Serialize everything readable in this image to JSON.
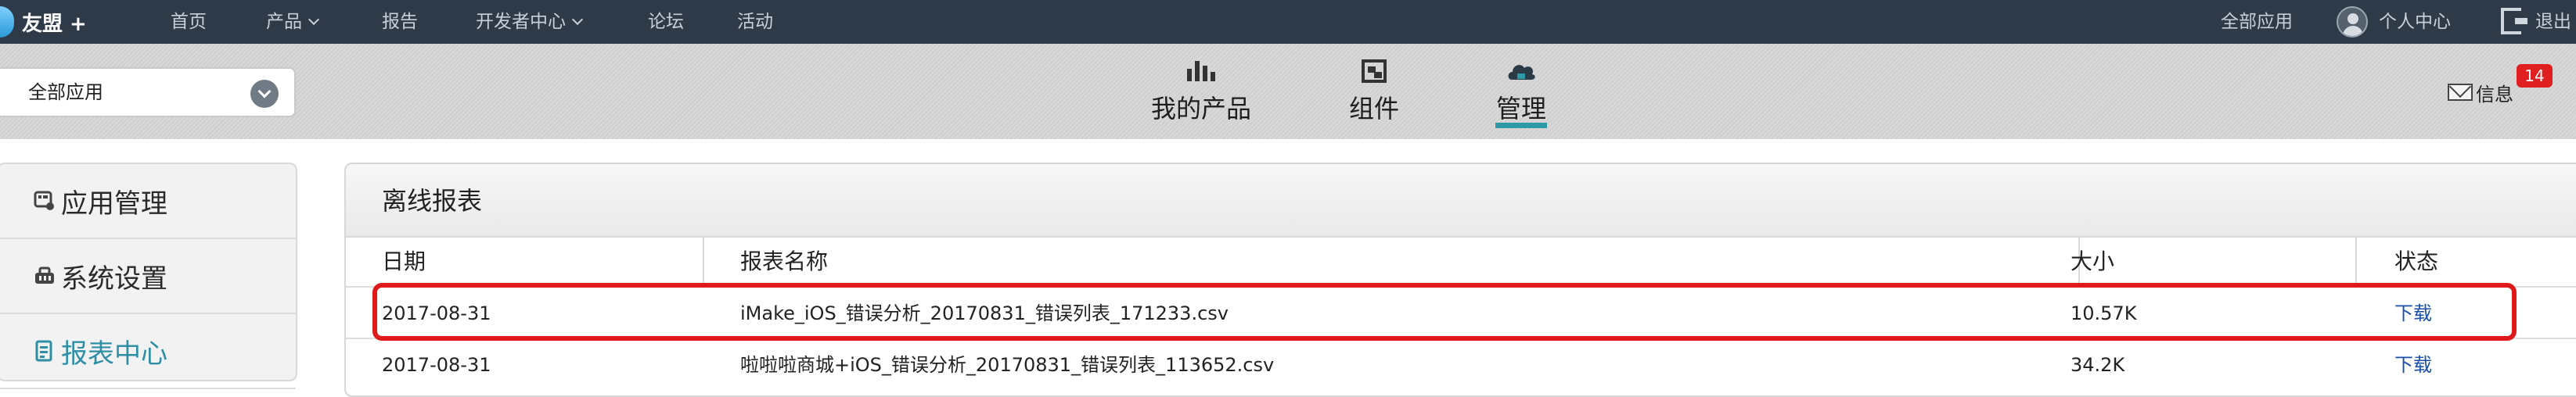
{
  "topnav": {
    "logo": "友盟 +",
    "items": [
      "首页",
      "产品",
      "报告",
      "开发者中心",
      "论坛",
      "活动"
    ],
    "right": {
      "all_apps": "全部应用",
      "user_center": "个人中心",
      "logout": "退出"
    }
  },
  "subbar": {
    "app_select": "全部应用",
    "tabs": [
      {
        "label": "我的产品",
        "icon": "bar-chart-icon"
      },
      {
        "label": "组件",
        "icon": "components-icon"
      },
      {
        "label": "管理",
        "icon": "cloud-manage-icon",
        "active": true
      }
    ],
    "messages": {
      "label": "信息",
      "count": "14"
    }
  },
  "sidebar": {
    "items": [
      {
        "label": "应用管理",
        "icon": "app-manage-icon"
      },
      {
        "label": "系统设置",
        "icon": "system-settings-icon"
      },
      {
        "label": "报表中心",
        "icon": "report-center-icon",
        "active": true
      }
    ]
  },
  "panel": {
    "title": "离线报表",
    "columns": [
      "日期",
      "报表名称",
      "大小",
      "状态"
    ],
    "rows": [
      {
        "date": "2017-08-31",
        "name": "iMake_iOS_错误分析_20170831_错误列表_171233.csv",
        "size": "10.57K",
        "status": "下载"
      },
      {
        "date": "2017-08-31",
        "name": "啦啦啦商城+iOS_错误分析_20170831_错误列表_113652.csv",
        "size": "34.2K",
        "status": "下载"
      }
    ]
  },
  "colors": {
    "topnav_bg": "#2f3a48",
    "accent": "#2e9aa6",
    "badge": "#e02020",
    "highlight": "#e01a1a",
    "link": "#1a4ea8"
  }
}
